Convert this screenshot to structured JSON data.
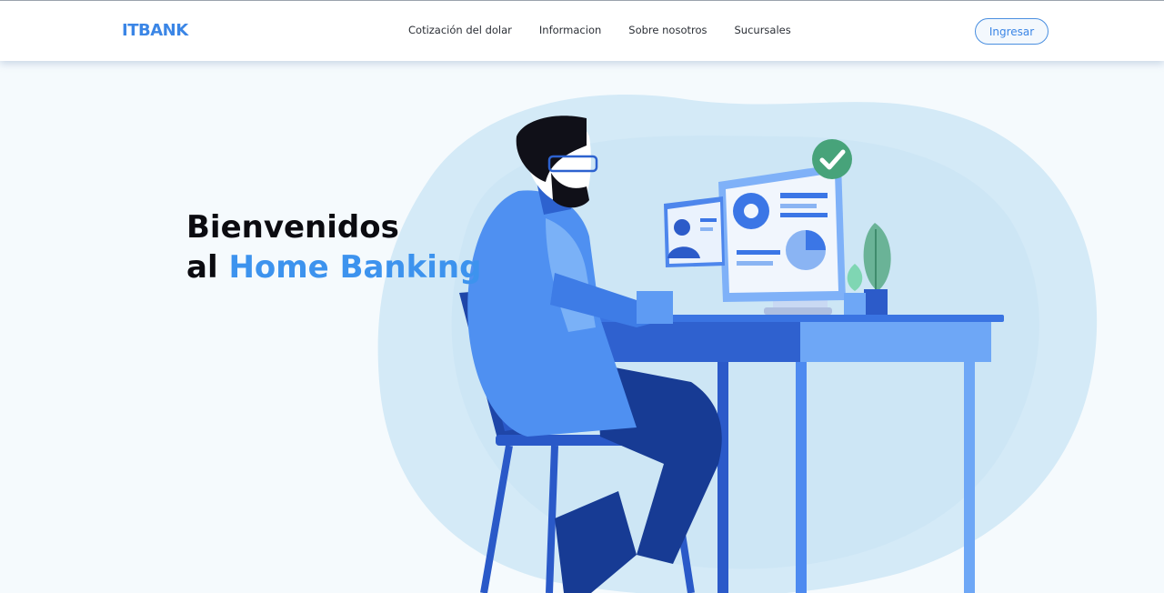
{
  "brand": {
    "logo_text": "ITBANK",
    "accent_color": "#3d93ee"
  },
  "nav": {
    "links": [
      {
        "label": "Cotización del dolar"
      },
      {
        "label": "Informacion"
      },
      {
        "label": "Sobre nosotros"
      },
      {
        "label": "Sucursales"
      }
    ],
    "login_label": "Ingresar"
  },
  "hero": {
    "line1": "Bienvenidos",
    "line2_prefix": "al ",
    "line2_accent": "Home Banking",
    "illustration": "person-at-desk-with-banking-dashboard"
  }
}
